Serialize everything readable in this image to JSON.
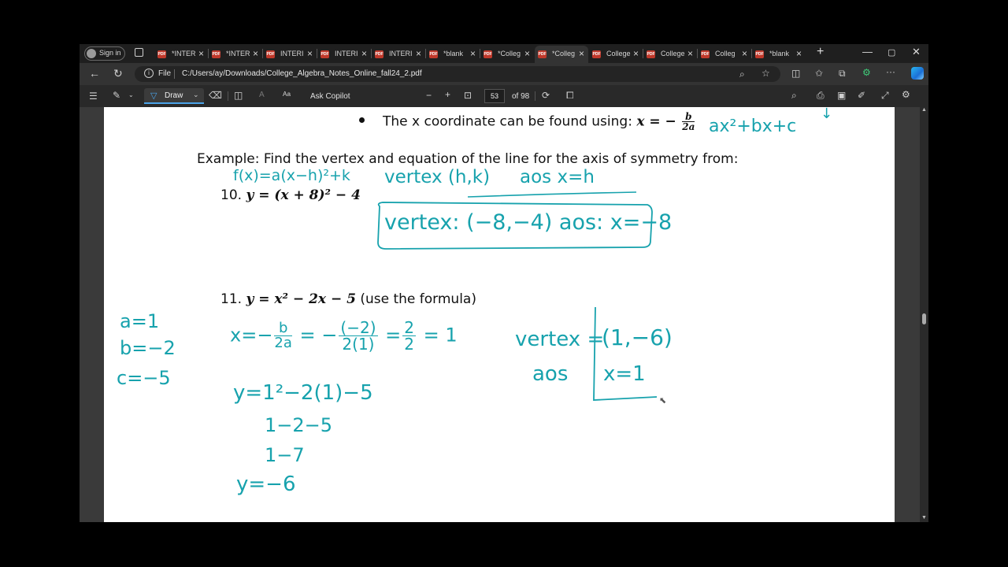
{
  "browser": {
    "sign_in": "Sign in",
    "tabs": [
      {
        "label": "*INTER",
        "active": false
      },
      {
        "label": "*INTER",
        "active": false
      },
      {
        "label": "INTERI",
        "active": false
      },
      {
        "label": "INTERI",
        "active": false
      },
      {
        "label": "INTERI",
        "active": false
      },
      {
        "label": "*blank",
        "active": false
      },
      {
        "label": "*Colleg",
        "active": false
      },
      {
        "label": "*Colleg",
        "active": true
      },
      {
        "label": "College",
        "active": false
      },
      {
        "label": "College",
        "active": false
      },
      {
        "label": "Colleg",
        "active": false
      },
      {
        "label": "*blank",
        "active": false
      }
    ],
    "new_tab": "+",
    "address": {
      "scheme_label": "File",
      "url": "C:/Users/ay/Downloads/College_Algebra_Notes_Online_fall24_2.pdf"
    }
  },
  "pdf_toolbar": {
    "draw_label": "Draw",
    "ask_copilot": "Ask Copilot",
    "page_number": "53",
    "page_total": "of 98"
  },
  "document": {
    "bullet_text": "The x coordinate can be found using:",
    "formula_lhs": "x = −",
    "formula_num": "b",
    "formula_den": "2a",
    "example_heading": "Example: Find the vertex and equation of the line for the axis of symmetry from:",
    "problem_10_num": "10.",
    "problem_10_eq": "y = (x + 8)² − 4",
    "problem_11_num": "11.",
    "problem_11_eq": "y = x² − 2x − 5",
    "problem_11_note": "(use the formula)"
  },
  "handwriting": {
    "standard_form": "ax²+bx+c",
    "vertex_form": "f(x)=a(x−h)²+k",
    "vertex_hk": "vertex (h,k)",
    "aos_h": "aos   x=h",
    "answer_10": "vertex: (−8,−4)    aos: x=−8",
    "coef_a": "a=1",
    "coef_b": "b=−2",
    "coef_c": "c=−5",
    "x_calc_lhs": "x=−",
    "x_calc_num": "b",
    "x_calc_den": "2a",
    "x_calc_mid": "=  −",
    "x_calc_num2": "(−2)",
    "x_calc_den2": "2(1)",
    "x_calc_eq": "=",
    "x_calc_num3": "2",
    "x_calc_den3": "2",
    "x_calc_res": "= 1",
    "y_line1": "y=1²−2(1)−5",
    "y_line2": "1−2−5",
    "y_line3": "1−7",
    "y_line4": "y=−6",
    "vertex_label": "vertex =",
    "aos_label": "aos",
    "vertex_val": "(1,−6)",
    "aos_val": "x=1",
    "arrow": "↓"
  },
  "colors": {
    "ink": "#17a2ad",
    "page": "#ffffff",
    "chrome": "#1f1f1f"
  }
}
